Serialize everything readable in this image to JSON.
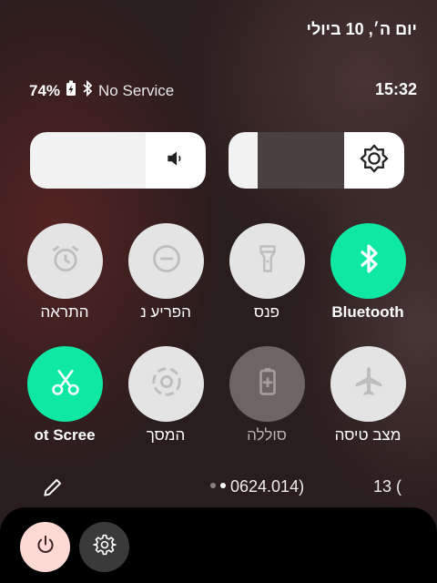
{
  "status": {
    "date": "יום ה׳, 10 ביולי",
    "battery": "74%",
    "service": "No Service",
    "time": "15:32"
  },
  "tiles": [
    {
      "label": "התראה",
      "icon": "alarm-icon",
      "state": "off"
    },
    {
      "label": "הפריע  נ",
      "icon": "do-not-disturb-icon",
      "state": "off"
    },
    {
      "label": "פנס",
      "icon": "flashlight-icon",
      "state": "off"
    },
    {
      "label": "Bluetooth",
      "icon": "bluetooth-icon",
      "state": "on"
    },
    {
      "label": "ot  Scree",
      "icon": "screenshot-icon",
      "state": "on"
    },
    {
      "label": "המסך",
      "icon": "screen-record-icon",
      "state": "off"
    },
    {
      "label": "סוללה",
      "icon": "battery-saver-icon",
      "state": "dim"
    },
    {
      "label": "מצב טיסה",
      "icon": "airplane-icon",
      "state": "off"
    }
  ],
  "footer": {
    "build": "0624.014)",
    "extra": "13 ("
  },
  "colors": {
    "tile_on": "#0fe8a3",
    "tile_off": "#e4e4e4",
    "power_button": "#ffd9d4"
  }
}
